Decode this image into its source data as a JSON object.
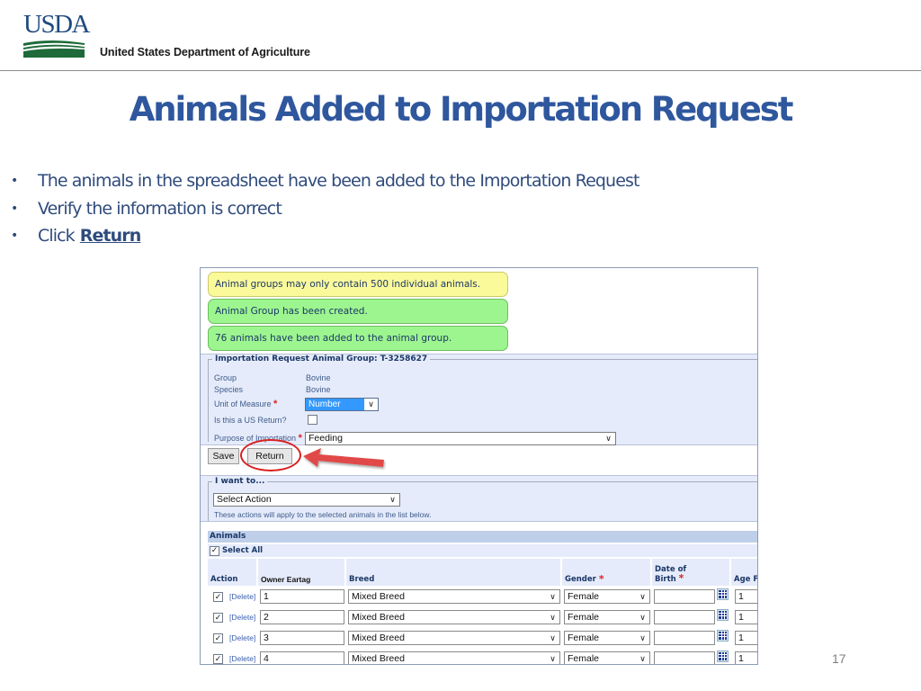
{
  "header": {
    "logo_text": "USDA",
    "agency_name": "United States Department of Agriculture",
    "colors": {
      "logo_blue": "#1f4a7f",
      "logo_green": "#1e6a3a"
    }
  },
  "slide": {
    "title": "Animals Added to Importation Request",
    "bullets": [
      {
        "text": "The animals in the spreadsheet have been added to the Importation Request"
      },
      {
        "text": "Verify the information is correct"
      },
      {
        "text": "Click",
        "emphasis": "Return"
      }
    ],
    "page_number": "17",
    "title_color": "#2f579e"
  },
  "app": {
    "messages": [
      {
        "type": "warning",
        "text": "Animal groups may only contain 500 individual animals.",
        "color": "#fbfa9b"
      },
      {
        "type": "success",
        "text": "Animal Group has been created.",
        "color": "#9df58f"
      },
      {
        "type": "success",
        "text": "76 animals have been added to the animal group.",
        "color": "#9df58f"
      }
    ],
    "group_panel": {
      "legend": "Importation Request Animal Group: T-3258627",
      "group_label": "Group",
      "group_value": "Bovine",
      "species_label": "Species",
      "species_value": "Bovine",
      "uom_label": "Unit of Measure",
      "uom_value": "Number",
      "us_return_label": "Is this a US Return?",
      "us_return_checked": false,
      "purpose_label": "Purpose of Importation",
      "purpose_value": "Feeding",
      "required_mark": "*"
    },
    "buttons": {
      "save": "Save",
      "return": "Return"
    },
    "action_panel": {
      "legend": "I want to...",
      "select_value": "Select Action",
      "help_text": "These actions will apply to the selected animals in the list below."
    },
    "animals": {
      "header": "Animals",
      "select_all_label": "Select All",
      "select_all_checked": true,
      "columns": {
        "action": "Action",
        "owner_eartag": "Owner Eartag",
        "breed": "Breed",
        "gender": "Gender",
        "dob_line1": "Date of",
        "dob_line2": "Birth",
        "age": "Age F"
      },
      "rows": [
        {
          "checked": true,
          "delete": "[Delete]",
          "eartag": "1",
          "breed": "Mixed Breed",
          "gender": "Female",
          "dob": "",
          "age": "1"
        },
        {
          "checked": true,
          "delete": "[Delete]",
          "eartag": "2",
          "breed": "Mixed Breed",
          "gender": "Female",
          "dob": "",
          "age": "1"
        },
        {
          "checked": true,
          "delete": "[Delete]",
          "eartag": "3",
          "breed": "Mixed Breed",
          "gender": "Female",
          "dob": "",
          "age": "1"
        },
        {
          "checked": true,
          "delete": "[Delete]",
          "eartag": "4",
          "breed": "Mixed Breed",
          "gender": "Female",
          "dob": "",
          "age": "1"
        }
      ]
    },
    "arrow_glyph": "∨",
    "check_glyph": "✓"
  }
}
